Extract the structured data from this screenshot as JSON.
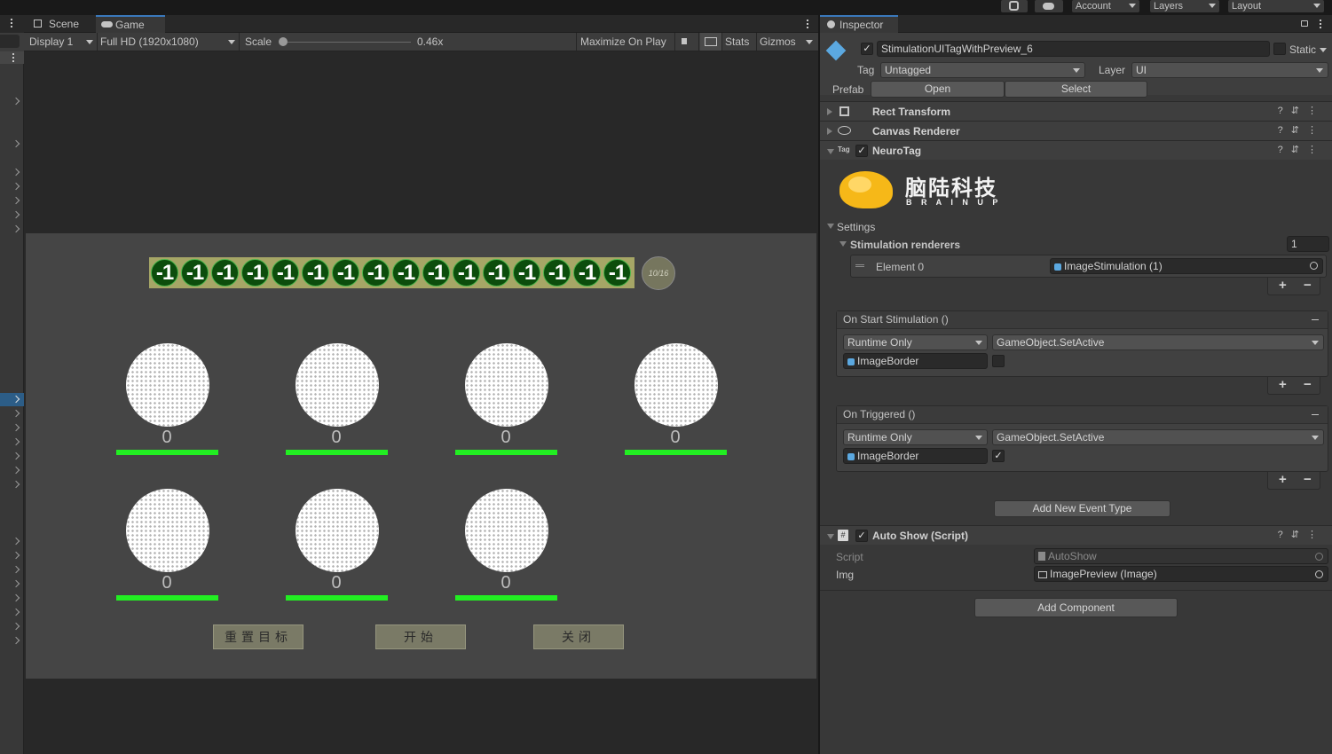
{
  "topbar": {
    "account": "Account",
    "layers": "Layers",
    "layout": "Layout"
  },
  "game_panel": {
    "tabs": [
      {
        "label": "Scene"
      },
      {
        "label": "Game"
      }
    ],
    "toolbar": {
      "display": "Display 1",
      "resolution": "Full HD (1920x1080)",
      "scale_label": "Scale",
      "scale_value": "0.46x",
      "maximize": "Maximize On Play",
      "stats": "Stats",
      "gizmos": "Gizmos"
    },
    "targets": [
      "-1",
      "-1",
      "-1",
      "-1",
      "-1",
      "-1",
      "-1",
      "-1",
      "-1",
      "-1",
      "-1",
      "-1",
      "-1",
      "-1",
      "-1",
      "-1"
    ],
    "progress": "10/16",
    "stimuli": [
      {
        "count": "0"
      },
      {
        "count": "0"
      },
      {
        "count": "0"
      },
      {
        "count": "0"
      },
      {
        "count": "0"
      },
      {
        "count": "0"
      },
      {
        "count": "0"
      }
    ],
    "buttons": {
      "reset": "重置目标",
      "start": "开始",
      "close": "关闭"
    }
  },
  "inspector": {
    "tab": "Inspector",
    "object_name": "StimulationUITagWithPreview_6",
    "static_label": "Static",
    "tag_label": "Tag",
    "tag_value": "Untagged",
    "layer_label": "Layer",
    "layer_value": "UI",
    "prefab_label": "Prefab",
    "open_btn": "Open",
    "select_btn": "Select",
    "components": {
      "rect_transform": "Rect Transform",
      "canvas_renderer": "Canvas Renderer",
      "neurotag": "NeuroTag",
      "auto_show": "Auto Show (Script)"
    },
    "logo": {
      "cn": "脑陆科技",
      "en": "B R A I N U P"
    },
    "settings_label": "Settings",
    "stim_renderers_label": "Stimulation renderers",
    "stim_renderers_size": "1",
    "element0_label": "Element 0",
    "element0_value": "ImageStimulation (1)",
    "on_start": {
      "title": "On Start Stimulation ()",
      "runtime": "Runtime Only",
      "function": "GameObject.SetActive",
      "target": "ImageBorder",
      "checked": false
    },
    "on_triggered": {
      "title": "On Triggered ()",
      "runtime": "Runtime Only",
      "function": "GameObject.SetActive",
      "target": "ImageBorder",
      "checked": true
    },
    "add_event_type": "Add New Event Type",
    "script_label": "Script",
    "script_value": "AutoShow",
    "img_label": "Img",
    "img_value": "ImagePreview (Image)",
    "add_component": "Add Component"
  },
  "colors": {
    "accent_blue": "#3a79bb",
    "stim_bar_green": "#22ee22",
    "target_green": "#0c4d0c"
  }
}
